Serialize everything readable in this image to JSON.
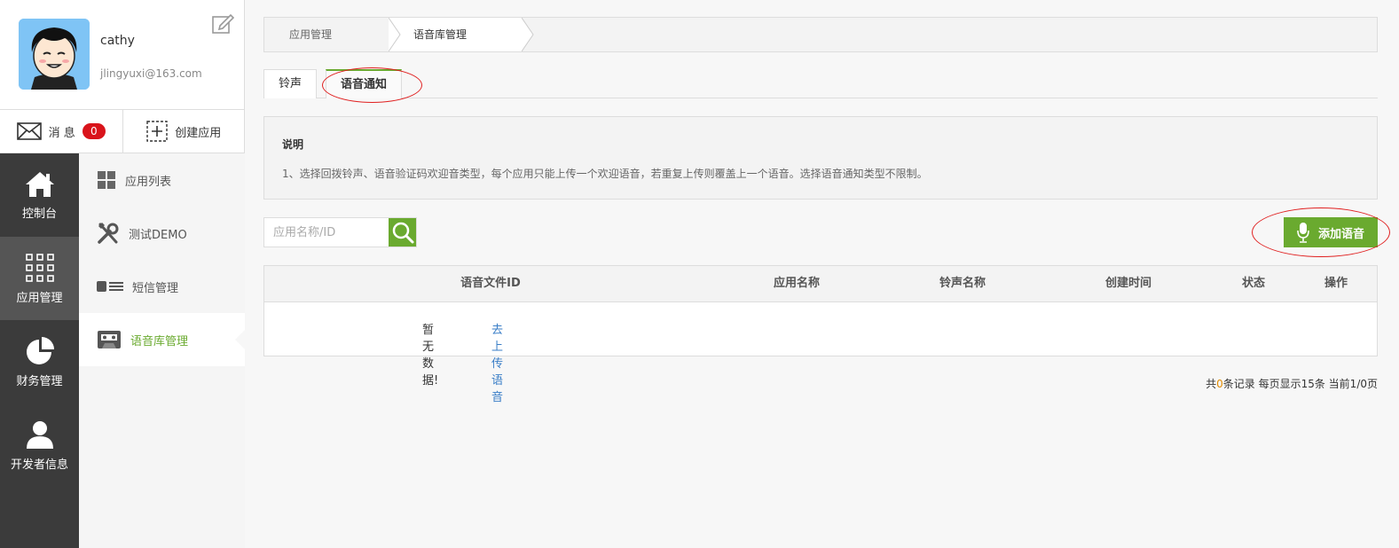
{
  "profile": {
    "username": "cathy",
    "email": "jlingyuxi@163.com"
  },
  "quick_bar": {
    "messages_label": "消 息",
    "messages_count": "0",
    "create_app_label": "创建应用"
  },
  "main_nav": [
    {
      "label": "控制台",
      "icon": "home-icon"
    },
    {
      "label": "应用管理",
      "icon": "apps-grid-icon"
    },
    {
      "label": "财务管理",
      "icon": "pie-chart-icon"
    },
    {
      "label": "开发者信息",
      "icon": "user-icon"
    }
  ],
  "sub_nav": [
    {
      "label": "应用列表",
      "icon": "grid-icon"
    },
    {
      "label": "测试DEMO",
      "icon": "tools-icon"
    },
    {
      "label": "短信管理",
      "icon": "list-icon"
    },
    {
      "label": "语音库管理",
      "icon": "cassette-icon"
    }
  ],
  "breadcrumb": [
    "应用管理",
    "语音库管理"
  ],
  "tabs": [
    "铃声",
    "语音通知"
  ],
  "notice": {
    "title": "说明",
    "text": "1、选择回拨铃声、语音验证码欢迎音类型，每个应用只能上传一个欢迎语音，若重复上传则覆盖上一个语音。选择语音通知类型不限制。"
  },
  "search": {
    "placeholder": "应用名称/ID"
  },
  "add_button_label": "添加语音",
  "table": {
    "columns": [
      "语音文件ID",
      "应用名称",
      "铃声名称",
      "创建时间",
      "状态",
      "操作"
    ],
    "empty_text": "暂无数据!",
    "empty_link": "去上传语音"
  },
  "pager": {
    "prefix": "共",
    "count": "0",
    "suffix": "条记录 每页显示15条 当前1/0页"
  },
  "colors": {
    "accent": "#6aaa2f",
    "badge": "#d9141b",
    "nav_dark": "#3b3b3b",
    "annotation": "#e02020"
  }
}
